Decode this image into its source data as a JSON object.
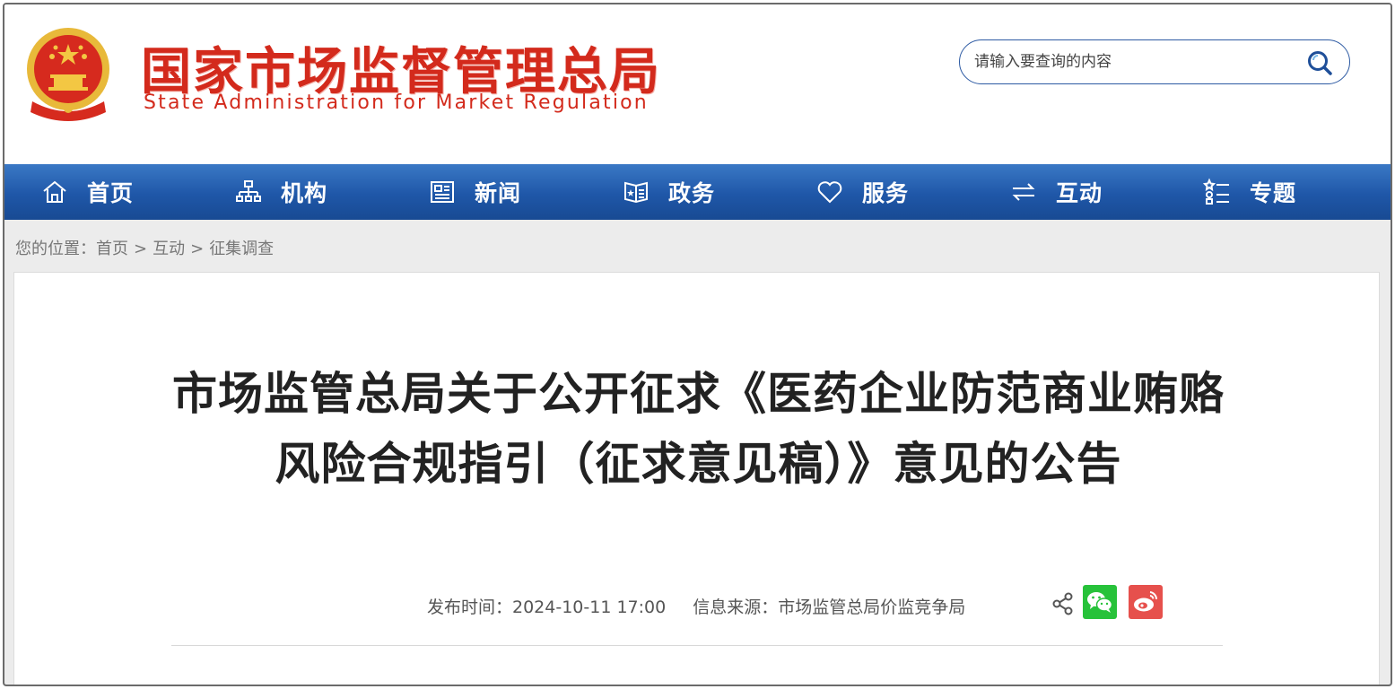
{
  "header": {
    "brand_cn": "国家市场监督管理总局",
    "brand_en": "State Administration for Market Regulation",
    "search_placeholder": "请输入要查询的内容"
  },
  "nav": [
    {
      "label": "首页",
      "icon": "home-icon"
    },
    {
      "label": "机构",
      "icon": "org-chart-icon"
    },
    {
      "label": "新闻",
      "icon": "newspaper-icon"
    },
    {
      "label": "政务",
      "icon": "government-icon"
    },
    {
      "label": "服务",
      "icon": "heart-icon"
    },
    {
      "label": "互动",
      "icon": "exchange-icon"
    },
    {
      "label": "专题",
      "icon": "topic-list-icon"
    }
  ],
  "breadcrumb": {
    "prefix": "您的位置：",
    "items": [
      "首页",
      "互动",
      "征集调查"
    ],
    "separator": ">"
  },
  "article": {
    "title": "市场监管总局关于公开征求《医药企业防范商业贿赂风险合规指引（征求意见稿）》意见的公告",
    "publish_time": "发布时间：2024-10-11 17:00",
    "source": "信息来源：市场监管总局价监竞争局"
  },
  "colors": {
    "brand_red": "#d32a1c",
    "nav_blue": "#1f57a8",
    "wechat_green": "#27c23a",
    "weibo_red": "#e6504c"
  }
}
